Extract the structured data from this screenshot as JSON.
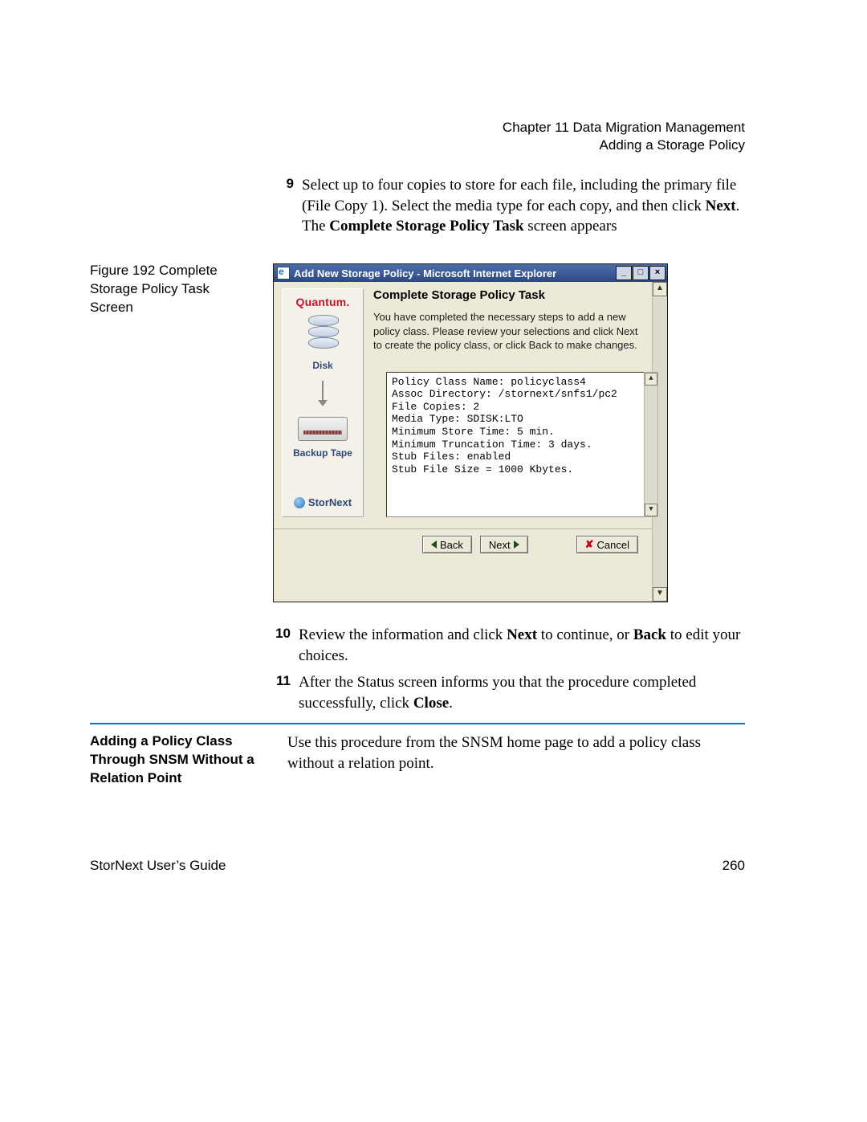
{
  "header": {
    "line1": "Chapter 11  Data Migration Management",
    "line2": "Adding a Storage Policy"
  },
  "steps_before": [
    {
      "num": "9",
      "body_parts": [
        {
          "t": "text",
          "v": "Select up to four copies to store for each file, including the primary file (File Copy 1). Select the media type for each copy, and then click "
        },
        {
          "t": "bold",
          "v": "Next"
        },
        {
          "t": "text",
          "v": ". The "
        },
        {
          "t": "bold",
          "v": "Complete Storage Policy Task"
        },
        {
          "t": "text",
          "v": " screen appears"
        }
      ]
    }
  ],
  "figure_caption": "Figure 192  Complete Storage Policy Task Screen",
  "ie": {
    "title": "Add New Storage Policy - Microsoft Internet Explorer",
    "sidebar": {
      "brand": "Quantum.",
      "disk_label": "Disk",
      "tape_label": "Backup Tape",
      "product": "StorNext"
    },
    "pane": {
      "title": "Complete Storage Policy Task",
      "desc": "You have completed the necessary steps to add a new policy class. Please review your selections and click Next to create the policy class, or click Back to make changes.",
      "summary_lines": [
        "Policy Class Name: policyclass4",
        "Assoc Directory: /stornext/snfs1/pc2",
        "File Copies: 2",
        "Media Type: SDISK:LTO",
        "Minimum Store Time: 5 min.",
        "Minimum Truncation Time: 3 days.",
        "Stub Files: enabled",
        "Stub File Size = 1000 Kbytes."
      ]
    },
    "buttons": {
      "back": "Back",
      "next": "Next",
      "cancel": "Cancel"
    }
  },
  "steps_after": [
    {
      "num": "10",
      "body_parts": [
        {
          "t": "text",
          "v": "Review the information and click "
        },
        {
          "t": "bold",
          "v": "Next"
        },
        {
          "t": "text",
          "v": " to continue, or "
        },
        {
          "t": "bold",
          "v": "Back"
        },
        {
          "t": "text",
          "v": " to edit your choices."
        }
      ]
    },
    {
      "num": "11",
      "body_parts": [
        {
          "t": "text",
          "v": "After the Status screen informs you that the procedure completed successfully, click "
        },
        {
          "t": "bold",
          "v": "Close"
        },
        {
          "t": "text",
          "v": "."
        }
      ]
    }
  ],
  "subsection": {
    "title": "Adding a Policy Class Through SNSM Without a Relation Point",
    "body": "Use this procedure from the SNSM home page to add a policy class without a relation point."
  },
  "footer": {
    "left": "StorNext User’s Guide",
    "right": "260"
  }
}
